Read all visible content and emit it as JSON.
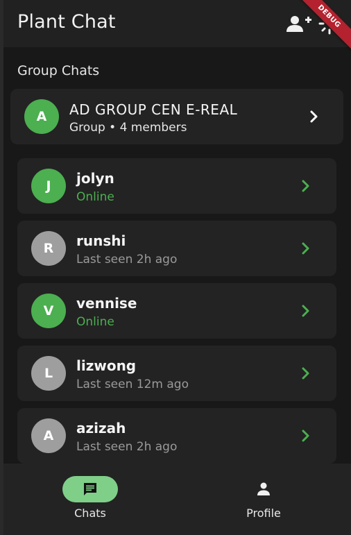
{
  "app": {
    "title": "Plant Chat",
    "debug_banner": "DEBUG"
  },
  "colors": {
    "online": "#4caf50",
    "offline_avatar": "#9e9e9e",
    "last_seen": "#9a9a9a",
    "chevron": "#4caf50",
    "nav_active_pill": "#7fcf88"
  },
  "section": {
    "group_chats_title": "Group Chats"
  },
  "group": {
    "avatar_letter": "A",
    "name": "AD GROUP CEN E-REAL",
    "subtitle": "Group • 4 members"
  },
  "users": [
    {
      "avatar_letter": "J",
      "name": "jolyn",
      "status": "Online",
      "online": true
    },
    {
      "avatar_letter": "R",
      "name": "runshi",
      "status": "Last seen 2h ago",
      "online": false
    },
    {
      "avatar_letter": "V",
      "name": "vennise",
      "status": "Online",
      "online": true
    },
    {
      "avatar_letter": "L",
      "name": "lizwong",
      "status": "Last seen 12m ago",
      "online": false
    },
    {
      "avatar_letter": "A",
      "name": "azizah",
      "status": "Last seen 2h ago",
      "online": false
    }
  ],
  "nav": {
    "chats_label": "Chats",
    "profile_label": "Profile"
  },
  "icons": {
    "add_user": "person-add-icon",
    "settings": "settings-icon",
    "chevron": "chevron-right-icon",
    "chats": "chat-bubble-icon",
    "profile": "person-icon"
  }
}
